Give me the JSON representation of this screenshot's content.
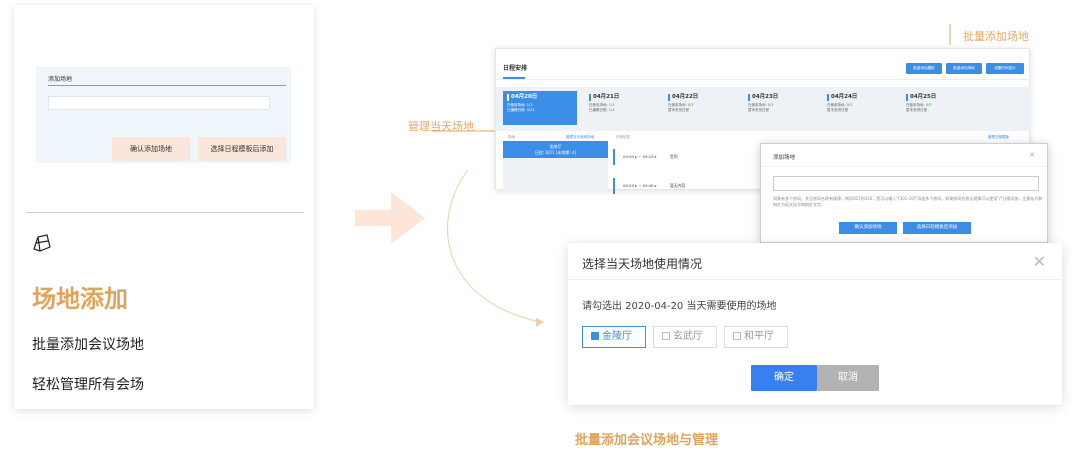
{
  "left_card": {
    "mini_dialog": {
      "label": "添加场地",
      "confirm_label": "确认添加场地",
      "template_label": "选择日程模板后添加"
    },
    "title": "场地添加",
    "subtitle1": "批量添加会议场地",
    "subtitle2": "轻松管理所有会场"
  },
  "annotations": {
    "batch_add": "批量添加场地",
    "manage_day": "管理当天场地"
  },
  "main_screen": {
    "header": "日程安排",
    "toolbar_buttons": [
      "批量添加模板",
      "批量添加场地",
      "设置时间显示"
    ],
    "dates": [
      {
        "date": "04月20日",
        "line1": "在使用场地: ",
        "v1": "1/3",
        "line2": "已编辑日程: ",
        "v2": "0/21"
      },
      {
        "date": "04月21日",
        "line1": "在使用场地: ",
        "v1": "1/3",
        "line2": "已编辑日程: ",
        "v2": "1/4"
      },
      {
        "date": "04月22日",
        "line1": "在使用场地: ",
        "v1": "0/3",
        "line2": "暂未安排日程",
        "v2": ""
      },
      {
        "date": "04月23日",
        "line1": "在使用场地: ",
        "v1": "0/3",
        "line2": "暂未安排日程",
        "v2": ""
      },
      {
        "date": "04月24日",
        "line1": "在使用场地: ",
        "v1": "0/3",
        "line2": "暂未安排日程",
        "v2": ""
      },
      {
        "date": "04月25日",
        "line1": "在使用场地: ",
        "v1": "0/3",
        "line2": "暂未安排日程",
        "v2": ""
      }
    ],
    "row_venue": "场地",
    "row_manage": "管理当天使用场地",
    "row_schedule": "日程信息",
    "row_right": "管理日程模板",
    "hall_name": "金陵厅",
    "hall_sub": "日程: 0/21 (未排期: 4)",
    "slots": [
      {
        "time": "09:00 ▸ ~ 09:15 ▸",
        "name": "签到"
      },
      {
        "time": "09:25 ▸ ~ 09:40 ▸",
        "name": "暂无内容"
      }
    ]
  },
  "add_dialog": {
    "title": "添加场地",
    "hint": "如果有多个房间，并且房间名称有规律，例如301到310，您可以输入\"[301-10]\"添加多个房间，如果房间名称无规律可以使用\"/\"分隔添加，注意括号和斜杠为英文括号和斜杠文字。",
    "confirm": "确认添加场地",
    "template": "选择日程模板后添加"
  },
  "select_dialog": {
    "title": "选择当天场地使用情况",
    "question": "请勾选出 2020-04-20 当天需要使用的场地",
    "options": [
      {
        "label": "金陵厅",
        "checked": true
      },
      {
        "label": "玄武厅",
        "checked": false
      },
      {
        "label": "和平厅",
        "checked": false
      }
    ],
    "ok": "确定",
    "cancel": "取消"
  },
  "caption": "批量添加会议场地与管理",
  "colors": {
    "accent": "#e0a35c",
    "primary_blue": "#3a8ee6",
    "peach": "#fbe6dc"
  }
}
